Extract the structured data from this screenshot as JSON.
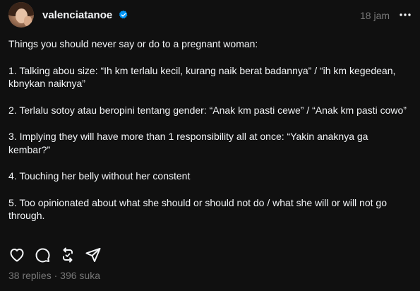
{
  "post": {
    "username": "valenciatanoe",
    "timestamp": "18 jam",
    "intro": "Things you should never say or do to a pregnant woman:",
    "points": [
      "1. Talking abou size: “Ih km terlalu kecil, kurang naik berat badannya” / “ih km kegedean, kbnykan naiknya”",
      "2. Terlalu sotoy atau beropini tentang gender: “Anak km pasti cewe” / “Anak km pasti cowo”",
      "3. Implying they will have more than 1 responsibility all at once: “Yakin anaknya ga kembar?”",
      "4. Touching her belly without her constent",
      "5. Too opinionated about what she should or should not do / what she will or will not go through."
    ],
    "replies": "38 replies",
    "separator": "·",
    "likes": "396 suka"
  },
  "icons": {
    "verified": "verified-badge-icon",
    "more": "more-options-icon",
    "like": "heart-icon",
    "reply": "comment-icon",
    "repost": "repost-icon",
    "share": "share-icon"
  },
  "colors": {
    "background": "#101010",
    "text": "#f3f5f7",
    "muted": "#777777",
    "verified": "#0095f6"
  }
}
